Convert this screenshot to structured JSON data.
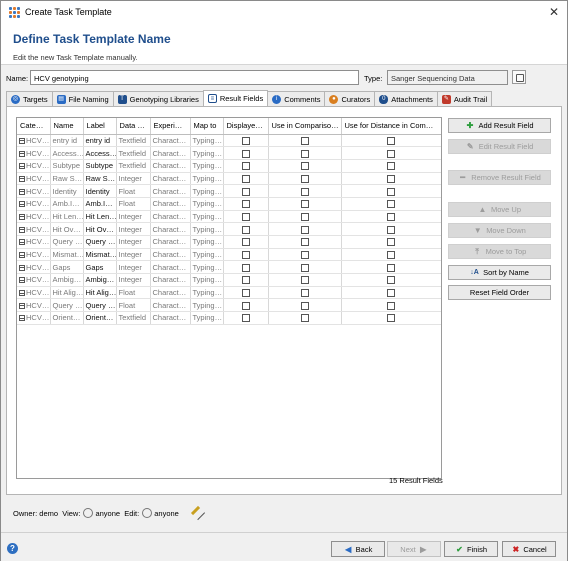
{
  "window": {
    "title": "Create Task Template",
    "close_glyph": "✕"
  },
  "header": {
    "title": "Define Task Template Name",
    "subtitle": "Edit the new Task Template manually."
  },
  "form": {
    "name_label": "Name:",
    "name_value": "HCV genotyping",
    "type_label": "Type:",
    "type_value": "Sanger Sequencing Data"
  },
  "tabs": [
    {
      "label": "Targets",
      "icon": "targets-icon",
      "color": "#2a6bc4"
    },
    {
      "label": "File Naming",
      "icon": "file-naming-icon",
      "color": "#2a6bc4"
    },
    {
      "label": "Genotyping Libraries",
      "icon": "library-icon",
      "color": "#1f4e8c"
    },
    {
      "label": "Result Fields",
      "icon": "result-fields-icon",
      "color": "#1f4e8c"
    },
    {
      "label": "Comments",
      "icon": "comments-icon",
      "color": "#2a6bc4"
    },
    {
      "label": "Curators",
      "icon": "curators-icon",
      "color": "#d97f20"
    },
    {
      "label": "Attachments",
      "icon": "attachments-icon",
      "color": "#1f4e8c"
    },
    {
      "label": "Audit Trail",
      "icon": "audit-trail-icon",
      "color": "#c0392b"
    }
  ],
  "active_tab": "Result Fields",
  "grid": {
    "columns": [
      "Cate…",
      "Name",
      "Label",
      "Data …",
      "Experi…",
      "Map to",
      "Displaye…",
      "Use in Compariso…",
      "Use for Distance in Com…"
    ],
    "rows": [
      [
        "HCV…",
        "entry id",
        "entry id",
        "Textfield",
        "Charact…",
        "Typing…"
      ],
      [
        "HCV…",
        "Access…",
        "Access…",
        "Textfield",
        "Charact…",
        "Typing…"
      ],
      [
        "HCV…",
        "Subtype",
        "Subtype",
        "Textfield",
        "Charact…",
        "Typing…"
      ],
      [
        "HCV…",
        "Raw S…",
        "Raw S…",
        "Integer",
        "Charact…",
        "Typing…"
      ],
      [
        "HCV…",
        "Identity",
        "Identity",
        "Float",
        "Charact…",
        "Typing…"
      ],
      [
        "HCV…",
        "Amb.I…",
        "Amb.I…",
        "Float",
        "Charact…",
        "Typing…"
      ],
      [
        "HCV…",
        "Hit Len…",
        "Hit Len…",
        "Integer",
        "Charact…",
        "Typing…"
      ],
      [
        "HCV…",
        "Hit Ov…",
        "Hit Ov…",
        "Integer",
        "Charact…",
        "Typing…"
      ],
      [
        "HCV…",
        "Query …",
        "Query …",
        "Integer",
        "Charact…",
        "Typing…"
      ],
      [
        "HCV…",
        "Mismat…",
        "Mismat…",
        "Integer",
        "Charact…",
        "Typing…"
      ],
      [
        "HCV…",
        "Gaps",
        "Gaps",
        "Integer",
        "Charact…",
        "Typing…"
      ],
      [
        "HCV…",
        "Ambig…",
        "Ambig…",
        "Integer",
        "Charact…",
        "Typing…"
      ],
      [
        "HCV…",
        "Hit Alig…",
        "Hit Alig…",
        "Float",
        "Charact…",
        "Typing…"
      ],
      [
        "HCV…",
        "Query …",
        "Query …",
        "Float",
        "Charact…",
        "Typing…"
      ],
      [
        "HCV…",
        "Orient…",
        "Orient…",
        "Textfield",
        "Charact…",
        "Typing…"
      ]
    ],
    "count_text": "15 Result Fields"
  },
  "side_buttons": {
    "add": "Add Result Field",
    "edit": "Edit Result Field",
    "remove": "Remove Result Field",
    "up": "Move Up",
    "down": "Move Down",
    "top": "Move to Top",
    "sort": "Sort by Name",
    "reset": "Reset Field Order"
  },
  "owner": {
    "owner_label": "Owner:",
    "owner_value": "demo",
    "view_label": "View:",
    "view_value": "anyone",
    "edit_label": "Edit:",
    "edit_value": "anyone"
  },
  "footer": {
    "help": "?",
    "back": "Back",
    "next": "Next",
    "finish": "Finish",
    "cancel": "Cancel"
  },
  "colors": {
    "accent": "#1f4e8c",
    "green": "#2e9e3e",
    "red": "#cc2222"
  }
}
